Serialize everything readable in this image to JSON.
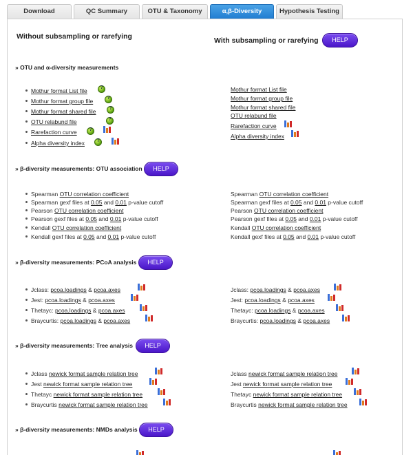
{
  "tabs": [
    "Download",
    "QC Summary",
    "OTU & Taxonomy",
    "α,β-Diversity",
    "Hypothesis Testing"
  ],
  "columns": {
    "left": "Without subsampling or rarefying",
    "right": "With subsampling or rarefying"
  },
  "help_label": "HELP",
  "sections": {
    "otu": "» OTU and α-diversity measurements",
    "assoc": "» β-diversity measurements: OTU association",
    "pcoa": "» β-diversity measurements: PCoA analysis",
    "tree": "» β-diversity measurements: Tree analysis",
    "nmds": "» β-diversity measurements: NMDs analysis"
  },
  "otu_items": [
    "Mothur format List file",
    "Mothur format group file",
    "Mothur format shared file",
    "OTU relabund file",
    "Rarefaction curve",
    "Alpha diversity index"
  ],
  "assoc_rows": [
    {
      "pre": "Spearman ",
      "link": "OTU correlation coefficient"
    },
    {
      "pre": "Spearman gexf files at ",
      "a": "0.05",
      "mid": " and ",
      "b": "0.01",
      "post": " p-value cutoff"
    },
    {
      "pre": "Pearson ",
      "link": "OTU correlation coefficient"
    },
    {
      "pre": "Pearson gexf files at ",
      "a": "0.05",
      "mid": " and ",
      "b": "0.01",
      "post": " p-value cutoff"
    },
    {
      "pre": "Kendall ",
      "link": "OTU correlation coefficient"
    },
    {
      "pre": "Kendall gexf files at ",
      "a": "0.05",
      "mid": " and ",
      "b": "0.01",
      "post": " p-value cutoff"
    }
  ],
  "pcoa_rows": [
    {
      "pre": "Jclass: ",
      "a": "pcoa.loadings",
      "mid": " & ",
      "b": "pcoa.axes"
    },
    {
      "pre": "Jest: ",
      "a": "pcoa.loadings",
      "mid": " & ",
      "b": "pcoa.axes"
    },
    {
      "pre": "Thetayc: ",
      "a": "pcoa.loadings",
      "mid": " & ",
      "b": "pcoa.axes"
    },
    {
      "pre": "Braycurtis: ",
      "a": "pcoa.loadings",
      "mid": " & ",
      "b": "pcoa.axes"
    }
  ],
  "tree_rows": [
    {
      "pre": "Jclass ",
      "link": "newick format sample relation tree"
    },
    {
      "pre": "Jest ",
      "link": "newick format sample relation tree"
    },
    {
      "pre": "Thetayc ",
      "link": "newick format sample relation tree"
    },
    {
      "pre": "Braycurtis ",
      "link": "newick format sample relation tree"
    }
  ],
  "icons": {
    "info": "green-help-icon",
    "chart": "chart-icon"
  }
}
